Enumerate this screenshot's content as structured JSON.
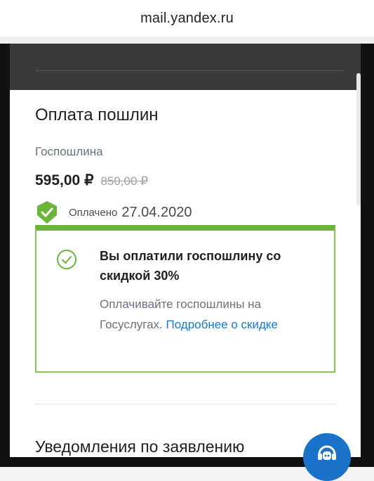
{
  "browser": {
    "url": "mail.yandex.ru"
  },
  "payment": {
    "section_title": "Оплата пошлин",
    "fee_label": "Госпошлина",
    "price_current": "595,00 ₽",
    "price_old": "850,00 ₽",
    "paid_label": "Оплачено",
    "paid_date": "27.04.2020"
  },
  "discount": {
    "title": "Вы оплатили госпошлину со скидкой 30%",
    "text": "Оплачивайте госпошлины на Госуслугах. ",
    "link": "Подробнее о скидке"
  },
  "notifications": {
    "title": "Уведомления по заявлению"
  },
  "colors": {
    "accent_green": "#6bb53a",
    "link_blue": "#1778c9",
    "support_blue": "#1b73c9"
  },
  "icons": {
    "paid": "shield-check-icon",
    "discount": "check-circle-icon",
    "support": "support-robot-icon"
  }
}
